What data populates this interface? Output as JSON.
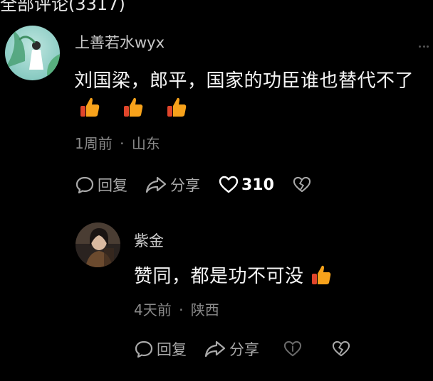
{
  "header": {
    "title": "全部评论(3317)"
  },
  "comments": [
    {
      "username": "上善若水wyx",
      "text": "刘国梁，郎平，国家的功臣谁也替代不了",
      "emojis": [
        "thumbs-up",
        "thumbs-up",
        "thumbs-up"
      ],
      "time": "1周前",
      "separator": "·",
      "location": "山东",
      "reply_label": "回复",
      "share_label": "分享",
      "likes": "310",
      "menu_icon": "more-dots-icon"
    },
    {
      "username": "紫金",
      "text": "赞同，都是功不可没",
      "emojis": [
        "thumbs-up"
      ],
      "time": "4天前",
      "separator": "·",
      "location": "陕西",
      "reply_label": "回复",
      "share_label": "分享"
    }
  ],
  "colors": {
    "background": "#000000",
    "text": "#f5f5f5",
    "meta": "#8a8a8a",
    "thumb": "#f7a21b",
    "thumb_dark": "#e0452b"
  }
}
